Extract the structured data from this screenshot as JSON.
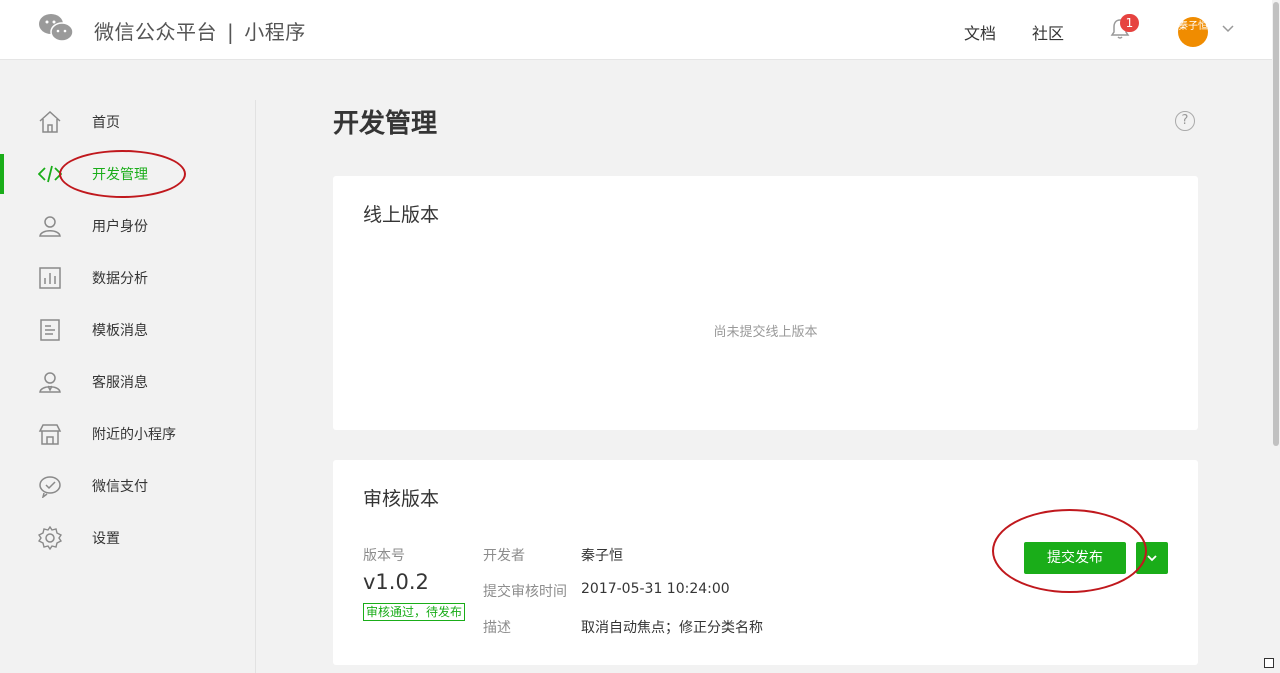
{
  "header": {
    "brand": "微信公众平台",
    "separator": "|",
    "product": "小程序",
    "docs": "文档",
    "community": "社区",
    "notification_count": "1",
    "avatar_text": "秦子恒"
  },
  "sidebar": {
    "items": [
      {
        "label": "首页",
        "icon": "home-icon"
      },
      {
        "label": "开发管理",
        "icon": "code-icon",
        "active": true
      },
      {
        "label": "用户身份",
        "icon": "user-icon"
      },
      {
        "label": "数据分析",
        "icon": "chart-icon"
      },
      {
        "label": "模板消息",
        "icon": "document-icon"
      },
      {
        "label": "客服消息",
        "icon": "support-icon"
      },
      {
        "label": "附近的小程序",
        "icon": "store-icon"
      },
      {
        "label": "微信支付",
        "icon": "wechat-pay-icon"
      },
      {
        "label": "设置",
        "icon": "gear-icon"
      }
    ]
  },
  "main": {
    "title": "开发管理",
    "help": "?",
    "online": {
      "title": "线上版本",
      "empty": "尚未提交线上版本"
    },
    "review": {
      "title": "审核版本",
      "version_label": "版本号",
      "version": "v1.0.2",
      "status": "审核通过，待发布",
      "developer_label": "开发者",
      "developer": "秦子恒",
      "time_label": "提交审核时间",
      "time": "2017-05-31 10:24:00",
      "desc_label": "描述",
      "desc": "取消自动焦点；修正分类名称",
      "submit_button": "提交发布"
    }
  },
  "colors": {
    "accent": "#1aad19",
    "badge": "#e64340",
    "annotation": "#c0181d"
  }
}
